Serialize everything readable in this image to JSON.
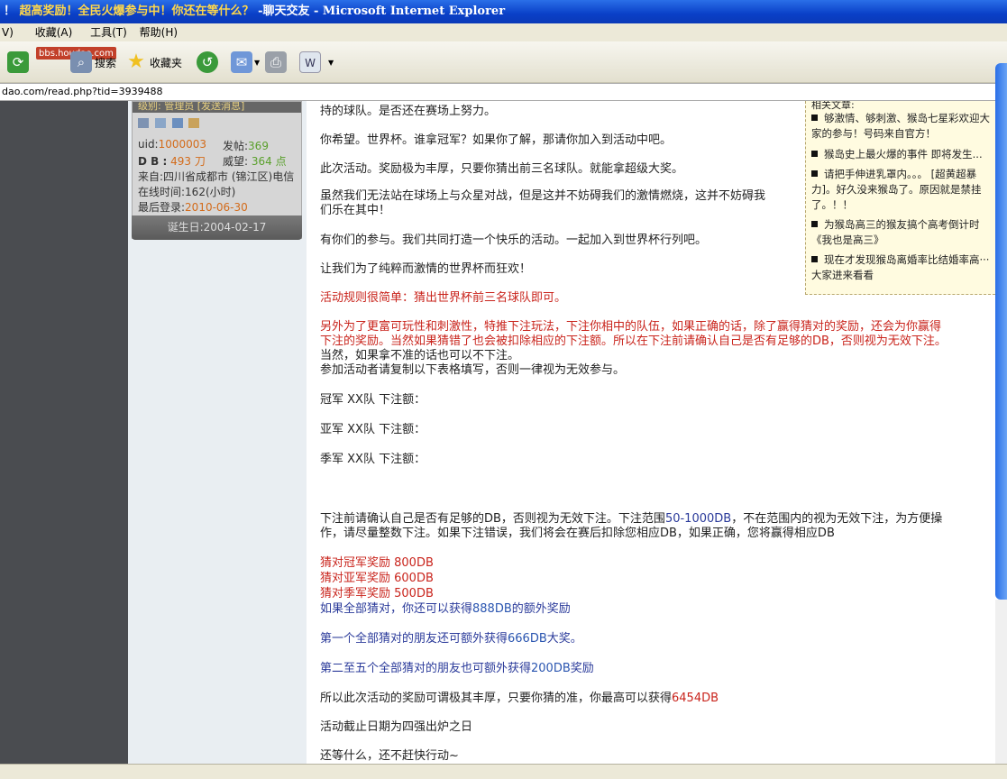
{
  "window": {
    "title_prefix": "！",
    "title_highlight": "超高奖励！全民火爆参与中！你还在等什么？",
    "title_rest": "-聊天交友 - Microsoft Internet Explorer"
  },
  "menu": {
    "items": [
      "V)",
      "收藏(A)",
      "工具(T)",
      "帮助(H)"
    ]
  },
  "toolbar": {
    "search_label": "搜索",
    "favorites_label": "收藏夹",
    "watermark": "bbs.houdao.com"
  },
  "address": {
    "url": "dao.com/read.php?tid=3939488"
  },
  "profile": {
    "level_text": "级别: 管理员 [发送消息]",
    "uid_label": "uid:",
    "uid": "1000003",
    "posts_label": "发帖:",
    "posts": "369",
    "db_label": "D B :",
    "db": "493 刀",
    "prestige_label": "威望:",
    "prestige": "364 点",
    "from": "来自:四川省成都市 (锦江区)电信",
    "online": "在线时间:162(小时)",
    "last_login_label": "最后登录:",
    "last_login": "2010-06-30",
    "birthday": "诞生日:2004-02-17"
  },
  "post": {
    "l1": "持的球队。是否还在赛场上努力。",
    "l2": "你希望。世界杯。谁拿冠军？如果你了解，那请你加入到活动中吧。",
    "l3": "此次活动。奖励极为丰厚，只要你猜出前三名球队。就能拿超级大奖。",
    "l4a": "虽然我们无法站在球场上与众星对战，但是这并不妨碍我们的激情燃烧，这并不妨碍我",
    "l4b": "们乐在其中！",
    "l5": "有你们的参与。我们共同打造一个快乐的活动。一起加入到世界杯行列吧。",
    "l6": "让我们为了纯粹而激情的世界杯而狂欢！",
    "rule": "活动规则很简单：猜出世界杯前三名球队即可。",
    "r2a": "另外为了更富可玩性和刺激性，特推下注玩法，下注你相中的队伍，如果正确的话，除了赢得猜对的奖励，还会为你赢得",
    "r2b": "下注的奖励。当然如果猜错了也会被扣除相应的下注额。所以在下注前请确认自己是否有足够的DB，否则视为无效下注。",
    "r3a": "当然，如果拿不准的话也可以不下注。",
    "r3b": "参加活动者请复制以下表格填写，否则一律视为无效参与。",
    "champ": "冠军  XX队  下注额：",
    "runner": "亚军  XX队  下注额：",
    "third": "季军  XX队  下注额：",
    "b1a_pre": "下注前请确认自己是否有足够的DB，否则视为无效下注。下注范围",
    "b1a_range": "50-1000DB",
    "b1a_post": "，不在范围内的视为无效下注，为方便操",
    "b1b": "作，请尽量整数下注。如果下注错误，我们将会在赛后扣除您相应DB，如果正确，您将赢得相应DB",
    "reward1": "猜对冠军奖励  800DB",
    "reward2": "猜对亚军奖励  600DB",
    "reward3": "猜对季军奖励  500DB",
    "all_pre": "如果全部猜对，你还可以获得",
    "all_val": "888DB",
    "all_post": "的额外奖励",
    "first_pre": "第一个全部猜对的朋友还可额外获得",
    "first_val": "666DB",
    "first_post": "大奖。",
    "second_pre": "第二至五个全部猜对的朋友也可额外获得",
    "second_val": "200DB",
    "second_post": "奖励",
    "max_pre": "所以此次活动的奖励可谓极其丰厚，只要你猜的准，你最高可以获得",
    "max_val": "6454DB",
    "deadline": "活动截止日期为四强出炉之日",
    "action": "还等什么，还不赶快行动~"
  },
  "related": {
    "heading": "相关文章:",
    "items": [
      "够激情、够刺激、猴岛七星彩欢迎大家的参与！号码来自官方！",
      "猴岛史上最火爆的事件 即将发生...",
      "请把手伸进乳罩内。。。    [超黄超暴力]。好久没来猴岛了。原因就是禁挂了。！！",
      "为猴岛高三的猴友搞个高考倒计时《我也是高三》",
      "现在才发现猴岛离婚率比结婚率高···大家进来看看"
    ]
  }
}
